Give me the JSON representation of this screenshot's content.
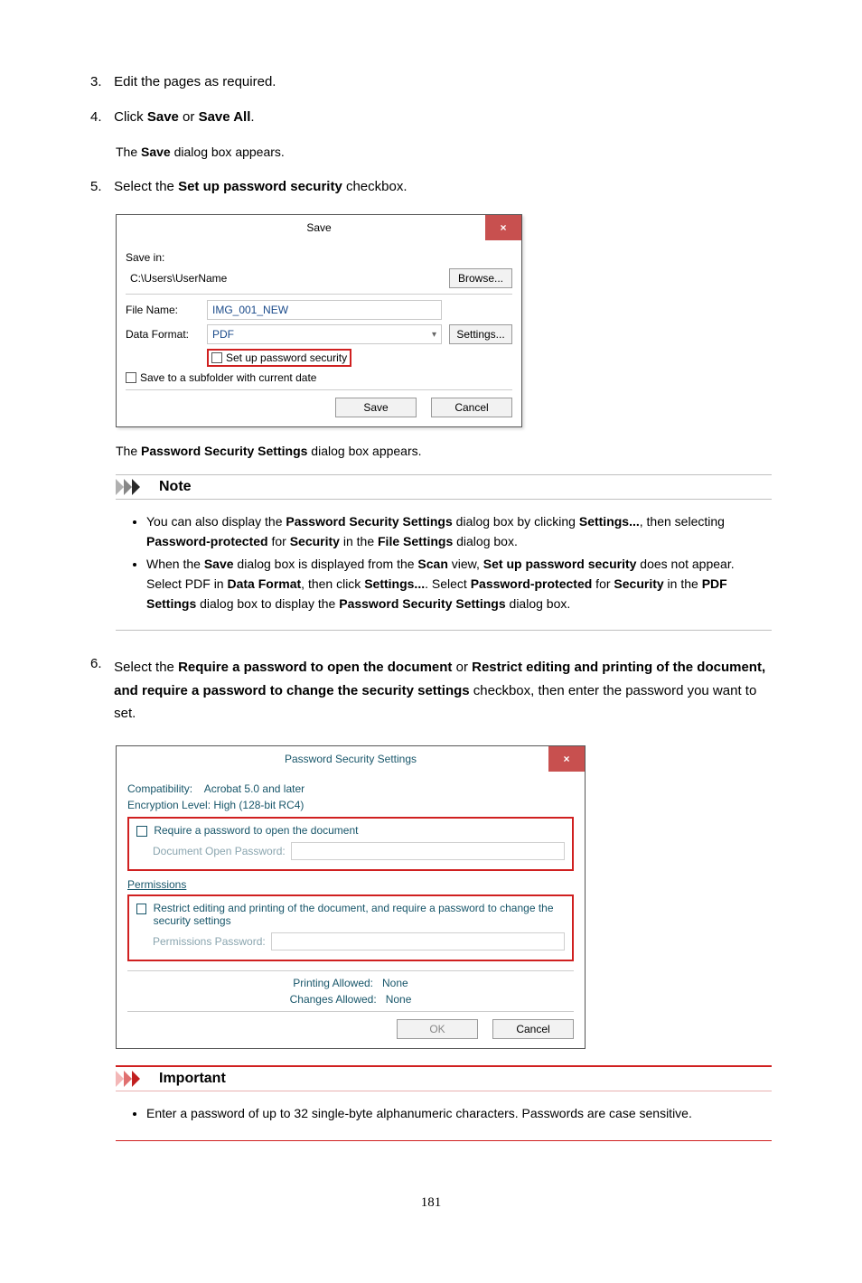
{
  "steps": {
    "s3": {
      "num": "3.",
      "text_a": "Edit the pages as required."
    },
    "s4": {
      "num": "4.",
      "text_a": "Click ",
      "text_b": "Save",
      "text_c": " or ",
      "text_d": "Save All",
      "text_e": ".",
      "sub_a": "The ",
      "sub_b": "Save",
      "sub_c": " dialog box appears."
    },
    "s5": {
      "num": "5.",
      "text_a": "Select the ",
      "text_b": "Set up password security",
      "text_c": " checkbox.",
      "sub2_a": "The ",
      "sub2_b": "Password Security Settings",
      "sub2_c": " dialog box appears."
    },
    "s6": {
      "num": "6.",
      "text_a": "Select the ",
      "text_b": "Require a password to open the document",
      "text_c": " or ",
      "text_d": "Restrict editing and printing of the document, and require a password to change the security settings",
      "text_e": " checkbox, then enter the password you want to set."
    }
  },
  "saveDialog": {
    "title": "Save",
    "close": "×",
    "saveInLbl": "Save in:",
    "saveInVal": "C:\\Users\\UserName",
    "browseBtn": "Browse...",
    "fileNameLbl": "File Name:",
    "fileNameVal": "IMG_001_NEW",
    "dataFormatLbl": "Data Format:",
    "dataFormatVal": "PDF",
    "settingsBtn": "Settings...",
    "pwSecLabel": "Set up password security",
    "subfolderLabel": "Save to a subfolder with current date",
    "saveBtn": "Save",
    "cancelBtn": "Cancel"
  },
  "note": {
    "heading": "Note",
    "li1_a": "You can also display the ",
    "li1_b": "Password Security Settings",
    "li1_c": " dialog box by clicking ",
    "li1_d": "Settings...",
    "li1_e": ", then selecting ",
    "li1_f": "Password-protected",
    "li1_g": " for ",
    "li1_h": "Security",
    "li1_i": " in the ",
    "li1_j": "File Settings",
    "li1_k": " dialog box.",
    "li2_a": "When the ",
    "li2_b": "Save",
    "li2_c": " dialog box is displayed from the ",
    "li2_d": "Scan",
    "li2_e": " view, ",
    "li2_f": "Set up password security",
    "li2_g": " does not appear. Select PDF in ",
    "li2_h": "Data Format",
    "li2_i": ", then click ",
    "li2_j": "Settings...",
    "li2_k": ". Select ",
    "li2_l": "Password-protected",
    "li2_m": " for ",
    "li2_n": "Security",
    "li2_o": " in the ",
    "li2_p": "PDF Settings",
    "li2_q": " dialog box to display the ",
    "li2_r": "Password Security Settings",
    "li2_s": " dialog box."
  },
  "pssDialog": {
    "title": "Password Security Settings",
    "close": "×",
    "compatLbl": "Compatibility:",
    "compatVal": "Acrobat 5.0 and later",
    "encLbl": "Encryption Level: High (128-bit RC4)",
    "reqOpen": "Require a password to open the document",
    "docOpenPwLbl": "Document Open Password:",
    "permsHeader": "Permissions",
    "restrictLbl": "Restrict editing and printing of the document, and require a password to change the security settings",
    "permPwLbl": "Permissions Password:",
    "printingLbl": "Printing Allowed:",
    "printingVal": "None",
    "changesLbl": "Changes Allowed:",
    "changesVal": "None",
    "okBtn": "OK",
    "cancelBtn": "Cancel"
  },
  "important": {
    "heading": "Important",
    "li1": "Enter a password of up to 32 single-byte alphanumeric characters. Passwords are case sensitive."
  },
  "pageNumber": "181"
}
